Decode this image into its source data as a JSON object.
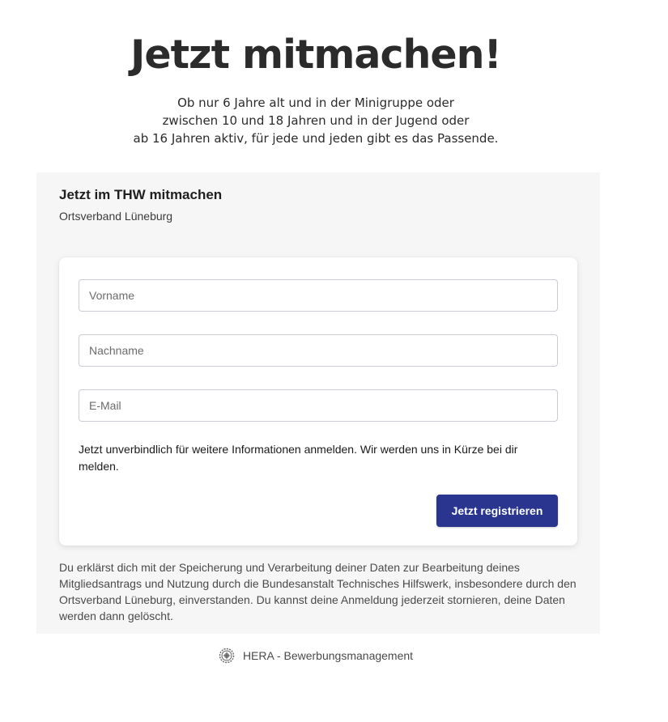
{
  "hero": {
    "title": "Jetzt mitmachen!",
    "subtitle_lines": [
      "Ob nur 6 Jahre alt und in der Minigruppe oder",
      "zwischen 10 und 18 Jahren und in der Jugend oder",
      "ab 16 Jahren aktiv, für jede und jeden gibt es das Passende."
    ]
  },
  "form": {
    "title": "Jetzt im THW mitmachen",
    "subtitle": "Ortsverband Lüneburg",
    "fields": {
      "first_name_placeholder": "Vorname",
      "last_name_placeholder": "Nachname",
      "email_placeholder": "E-Mail"
    },
    "info_text": "Jetzt unverbindlich für weitere Informationen anmelden. Wir werden uns in Kürze bei dir melden.",
    "submit_label": "Jetzt registrieren",
    "consent_text": "Du erklärst dich mit der Speicherung und Verarbeitung deiner Daten zur Bearbeitung deines Mitgliedsantrags und Nutzung durch die Bundesanstalt Technisches Hilfswerk, insbesondere durch den Ortsverband Lüneburg, einverstanden. Du kannst deine Anmeldung jederzeit stornieren, deine Daten werden dann gelöscht."
  },
  "footer": {
    "logo_icon": "gear-emblem-icon",
    "label": "HERA - Bewerbungsmanagement"
  },
  "colors": {
    "accent": "#2a3590",
    "panel_background": "#f6f6f6"
  }
}
